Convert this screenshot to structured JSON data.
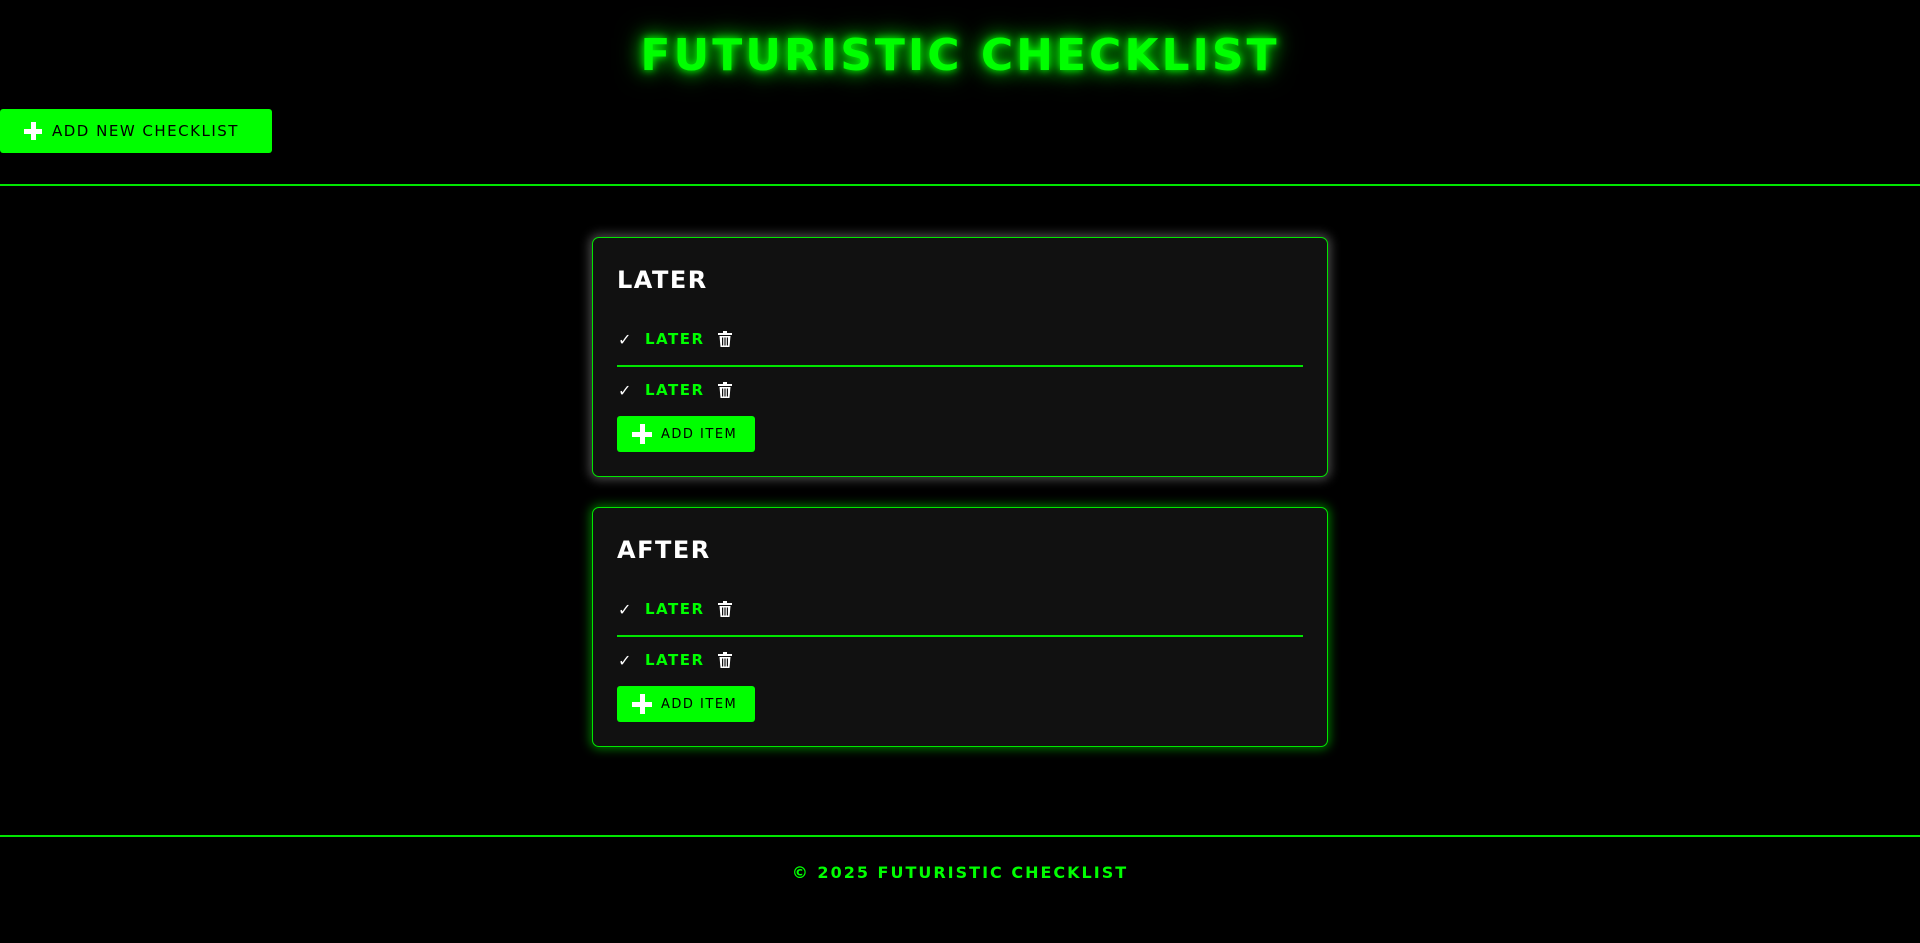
{
  "header": {
    "title": "FUTURISTIC CHECKLIST",
    "add_checklist_label": "ADD NEW CHECKLIST"
  },
  "checklists": [
    {
      "title": "LATER",
      "items": [
        {
          "check": "✓",
          "text": "LATER"
        },
        {
          "check": "✓",
          "text": "LATER"
        }
      ],
      "add_item_label": "ADD ITEM"
    },
    {
      "title": "AFTER",
      "items": [
        {
          "check": "✓",
          "text": "LATER"
        },
        {
          "check": "✓",
          "text": "LATER"
        }
      ],
      "add_item_label": "ADD ITEM"
    }
  ],
  "footer": {
    "text": "© 2025 FUTURISTIC CHECKLIST"
  },
  "colors": {
    "accent": "#00ff00",
    "background": "#000000",
    "card": "#111111",
    "text_light": "#ffffff"
  },
  "icons": {
    "add": "plus-icon",
    "check": "checkmark-icon",
    "delete": "trash-icon"
  }
}
